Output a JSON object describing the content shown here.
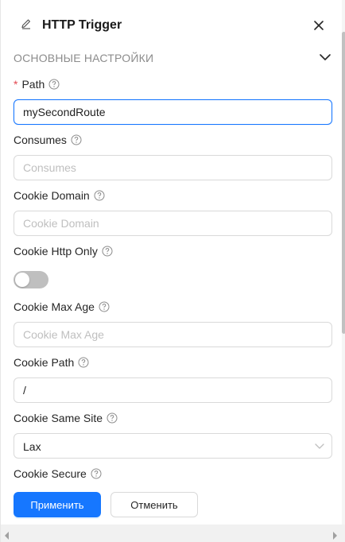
{
  "header": {
    "title": "HTTP Trigger"
  },
  "section": {
    "title": "ОСНОВНЫЕ НАСТРОЙКИ"
  },
  "fields": {
    "path": {
      "label": "Path",
      "required_mark": "*",
      "value": "mySecondRoute"
    },
    "consumes": {
      "label": "Consumes",
      "placeholder": "Consumes"
    },
    "cookie_domain": {
      "label": "Cookie Domain",
      "placeholder": "Cookie Domain"
    },
    "cookie_http_only": {
      "label": "Cookie Http Only",
      "checked": false
    },
    "cookie_max_age": {
      "label": "Cookie Max Age",
      "placeholder": "Cookie Max Age"
    },
    "cookie_path": {
      "label": "Cookie Path",
      "value": "/"
    },
    "cookie_same_site": {
      "label": "Cookie Same Site",
      "value": "Lax"
    },
    "cookie_secure": {
      "label": "Cookie Secure"
    }
  },
  "footer": {
    "apply_label": "Применить",
    "cancel_label": "Отменить"
  },
  "colors": {
    "primary": "#1677ff",
    "required": "#e34850",
    "toggle_off": "#bfbfbf"
  },
  "icons": {
    "edit": "edit-icon",
    "close": "close-icon",
    "chevron": "chevron-down-icon",
    "help": "question-circle-icon",
    "select_arrow": "chevron-down-icon"
  }
}
